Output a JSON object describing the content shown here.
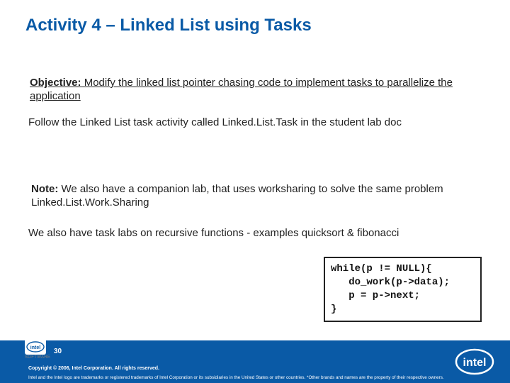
{
  "title": "Activity 4 – Linked List using Tasks",
  "p1": {
    "label": "Objective:",
    "text": " Modify the linked list pointer chasing code to implement tasks to parallelize the application"
  },
  "p2": "Follow the Linked List task activity called Linked.List.Task in the student lab doc",
  "p3": {
    "label": "Note:",
    "text": " We also have a companion lab, that uses worksharing to solve the same problem  Linked.List.Work.Sharing"
  },
  "p4": "We also have task labs on recursive functions  - examples quicksort & fibonacci",
  "code": "while(p != NULL){\n   do_work(p->data);\n   p = p->next;\n}",
  "footer": {
    "pagenum": "30",
    "copyright": "Copyright © 2006, Intel Corporation. All rights reserved.",
    "trademark": "Intel and the Intel logo are trademarks or registered trademarks of Intel Corporation or its subsidiaries in the United States or other countries. *Other brands and names are the property of their respective owners.",
    "software": "SOFTWARE"
  }
}
